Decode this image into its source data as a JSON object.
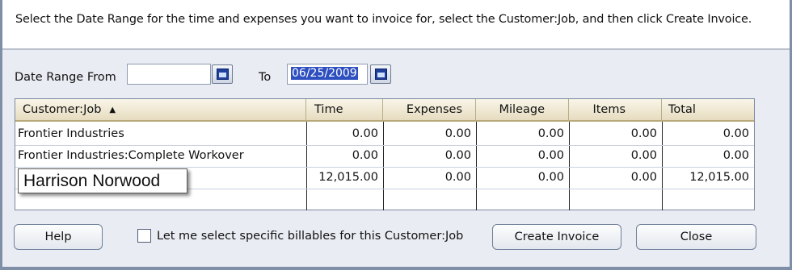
{
  "instructions": "Select the Date Range for the time and expenses you want to invoice for, select the Customer:Job, and then click Create Invoice.",
  "date_range": {
    "from_label": "Date Range From",
    "from_value": "",
    "to_label": "To",
    "to_value": "06/25/2009"
  },
  "grid": {
    "columns": [
      "Customer:Job",
      "Time",
      "Expenses",
      "Mileage",
      "Items",
      "Total"
    ],
    "sort_indicator": "▲",
    "rows": [
      {
        "customer": "Frontier Industries",
        "time": "0.00",
        "expenses": "0.00",
        "mileage": "0.00",
        "items": "0.00",
        "total": "0.00"
      },
      {
        "customer": "Frontier Industries:Complete Workover",
        "time": "0.00",
        "expenses": "0.00",
        "mileage": "0.00",
        "items": "0.00",
        "total": "0.00"
      },
      {
        "customer": "Harrison Norwood",
        "time": "12,015.00",
        "expenses": "0.00",
        "mileage": "0.00",
        "items": "0.00",
        "total": "12,015.00"
      }
    ]
  },
  "footer": {
    "help_label": "Help",
    "checkbox_label": "Let me select specific billables for this Customer:Job",
    "checkbox_checked": false,
    "create_invoice_label": "Create Invoice",
    "close_label": "Close"
  },
  "colors": {
    "header_bg": "#e6dcc0",
    "selection": "#2e4fbf",
    "dialog_bg": "#e9ecf2"
  }
}
